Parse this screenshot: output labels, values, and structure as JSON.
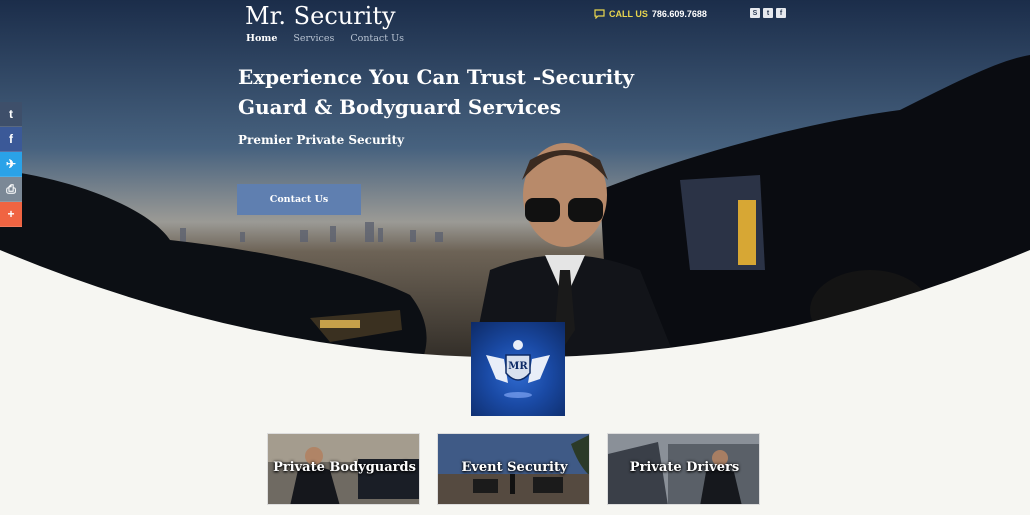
{
  "brand": {
    "name": "Mr. Security"
  },
  "nav": [
    {
      "label": "Home",
      "active": true
    },
    {
      "label": "Services",
      "active": false
    },
    {
      "label": "Contact Us",
      "active": false
    }
  ],
  "header": {
    "call_label": "CALL US",
    "phone": "786.609.7688",
    "social": [
      "S",
      "t",
      "f"
    ]
  },
  "hero": {
    "headline": "Experience You Can Trust -Security Guard & Bodyguard Services",
    "subheadline": "Premier Private Security",
    "cta_label": "Contact Us"
  },
  "share_bar": [
    {
      "glyph": "t",
      "color": "#3e4f6a"
    },
    {
      "glyph": "f",
      "color": "#3b5998"
    },
    {
      "glyph": "✈",
      "color": "#2aa2e8"
    },
    {
      "glyph": "⎙",
      "color": "#7b8896"
    },
    {
      "glyph": "+",
      "color": "#f06442"
    }
  ],
  "logo": {
    "text": "MR"
  },
  "services": [
    {
      "title": "Private Bodyguards"
    },
    {
      "title": "Event Security"
    },
    {
      "title": "Private Drivers"
    }
  ]
}
